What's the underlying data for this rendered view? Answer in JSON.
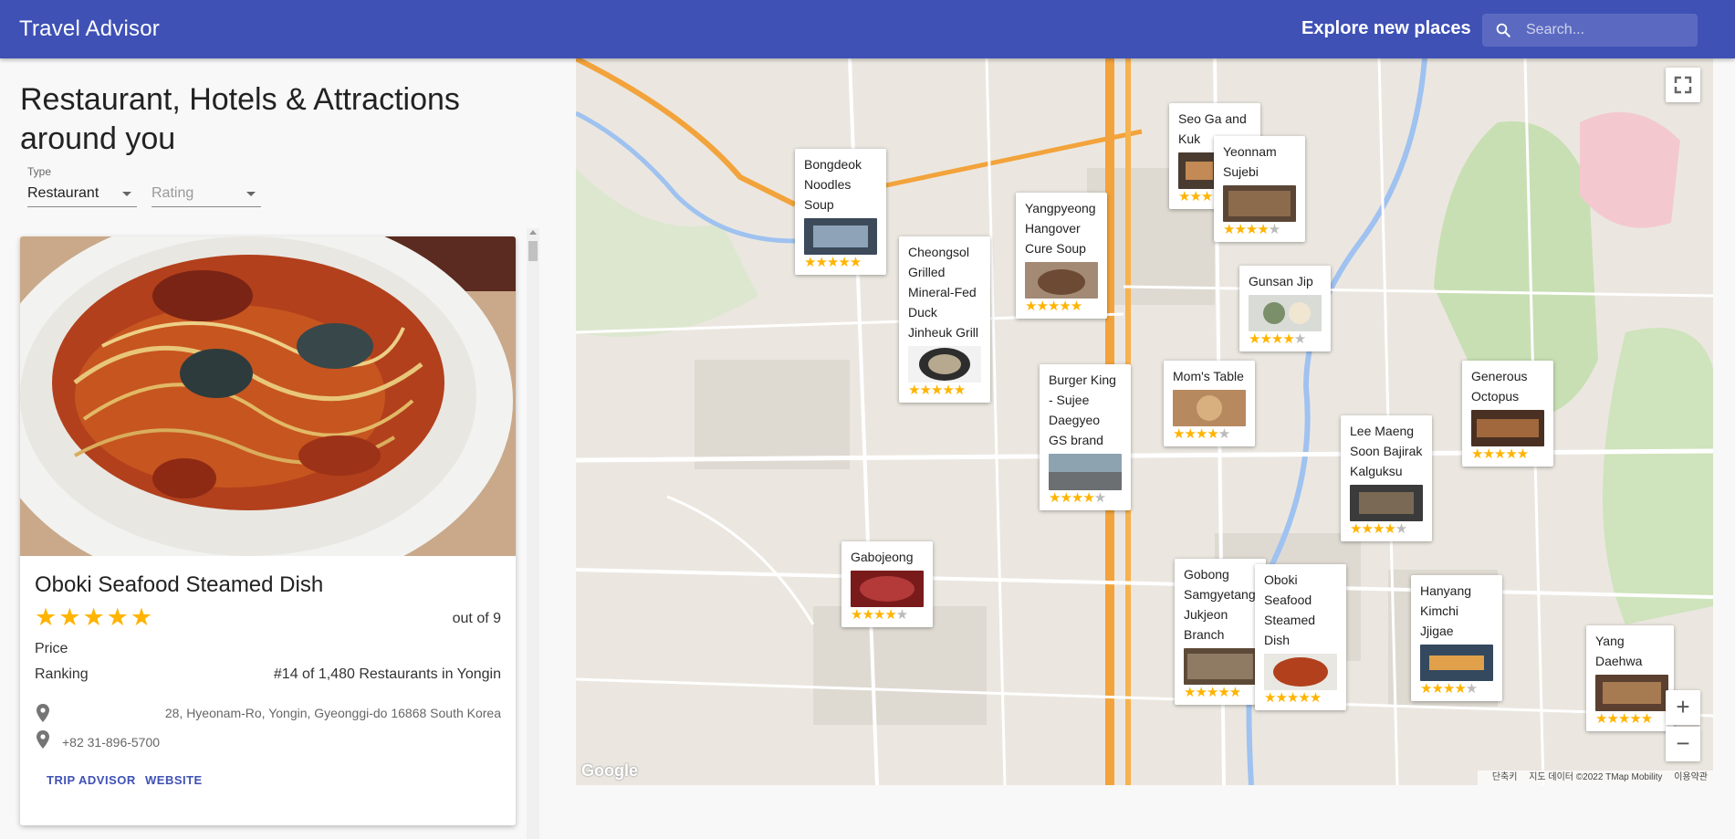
{
  "appbar": {
    "title": "Travel Advisor",
    "explore": "Explore new places",
    "search_placeholder": "Search..."
  },
  "panel": {
    "heading": "Restaurant, Hotels & Attractions around you",
    "type_label": "Type",
    "type_value": "Restaurant",
    "rating_placeholder": "Rating"
  },
  "place": {
    "name": "Oboki Seafood Steamed Dish",
    "rating": 5,
    "out_of": "out of 9",
    "price_label": "Price",
    "ranking_label": "Ranking",
    "ranking_value": "#14 of 1,480 Restaurants in Yongin",
    "address": "28, Hyeonam-Ro, Yongin, Gyeonggi-do 16868 South Korea",
    "phone": "+82 31-896-5700",
    "link_tripadvisor": "TRIP ADVISOR",
    "link_website": "WEBSITE"
  },
  "map": {
    "google": "Google",
    "attribution": [
      "단축키",
      "지도 데이터 ©2022 TMap Mobility",
      "이용약관"
    ],
    "zoom_in": "+",
    "zoom_out": "−",
    "markers": [
      {
        "name": "Bongdeok Noodles Soup",
        "stars": 5
      },
      {
        "name": "Cheongsol Grilled Mineral-Fed Duck Jinheuk Grill",
        "stars": 5
      },
      {
        "name": "Yangpyeong Hangover Cure Soup",
        "stars": 5
      },
      {
        "name": "Seo Ga and Kuk",
        "stars": 5
      },
      {
        "name": "Yeonnam Sujebi",
        "stars": 4
      },
      {
        "name": "Gunsan Jip",
        "stars": 4
      },
      {
        "name": "Mom's Table",
        "stars": 4
      },
      {
        "name": "Burger King - Sujee Daegyeo GS brand",
        "stars": 4
      },
      {
        "name": "Generous Octopus",
        "stars": 5
      },
      {
        "name": "Lee Maeng Soon Bajirak Kalguksu",
        "stars": 4
      },
      {
        "name": "Gabojeong",
        "stars": 4
      },
      {
        "name": "Gobong Samgyetang Jukjeon Branch",
        "stars": 5
      },
      {
        "name": "Oboki Seafood Steamed Dish",
        "stars": 5
      },
      {
        "name": "Hanyang Kimchi Jjigae",
        "stars": 4
      },
      {
        "name": "Yang Daehwa",
        "stars": 5
      }
    ]
  },
  "colors": {
    "appbar": "#3f51b5",
    "star": "#ffb400",
    "link": "#3f51b5"
  }
}
